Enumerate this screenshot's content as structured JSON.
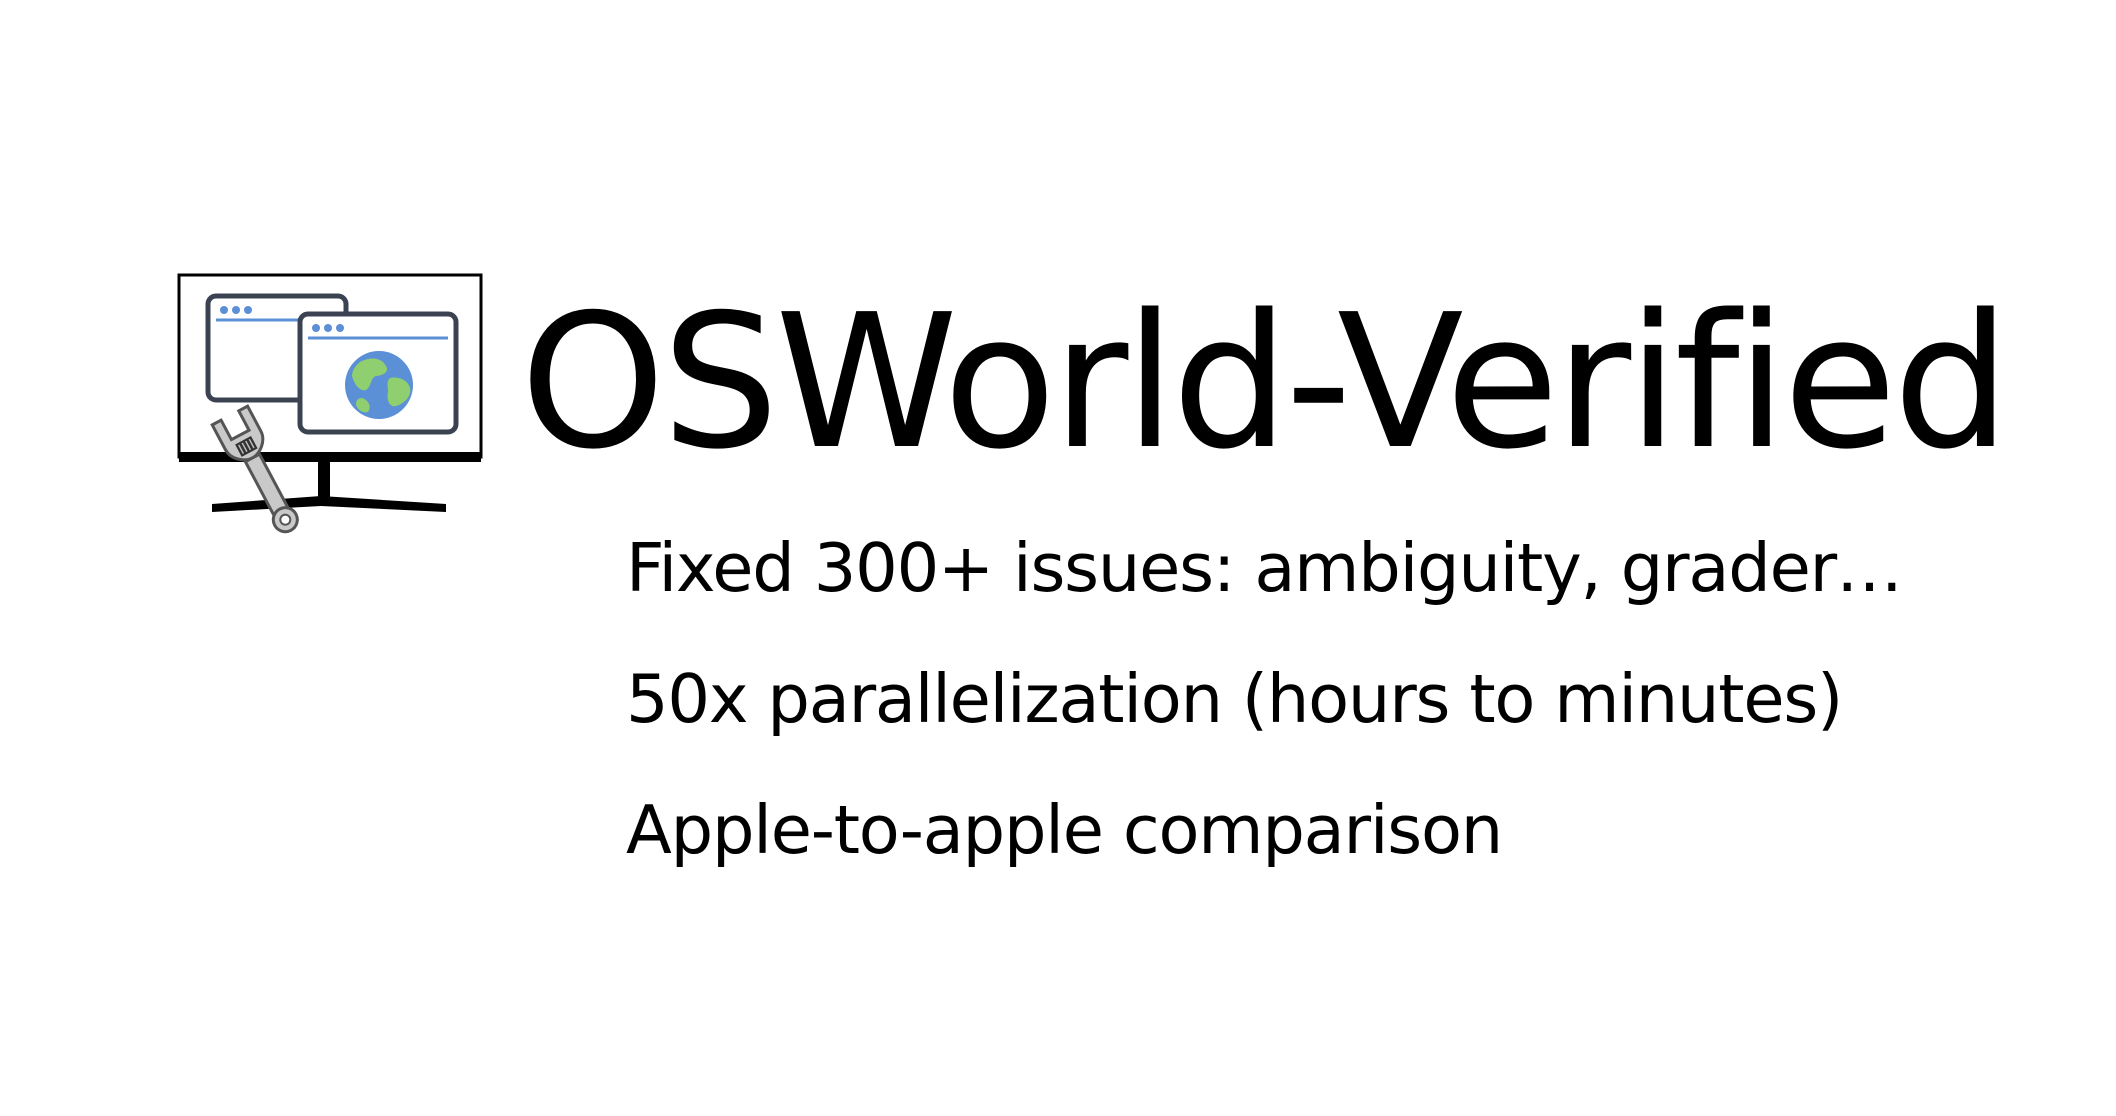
{
  "slide": {
    "title": "OSWorld-Verified",
    "bullets": [
      "Fixed 300+ issues: ambiguity, grader…",
      "50x parallelization (hours to minutes)",
      "Apple-to-apple comparison"
    ]
  },
  "logo": {
    "icon": "monitor-wrench-icon",
    "colors": {
      "frame": "#000000",
      "window_border": "#3b4352",
      "accent_blue": "#5b8fd6",
      "globe_water": "#5b8fd6",
      "globe_land": "#8fcf6f",
      "wrench": "#b8b8b8"
    }
  }
}
